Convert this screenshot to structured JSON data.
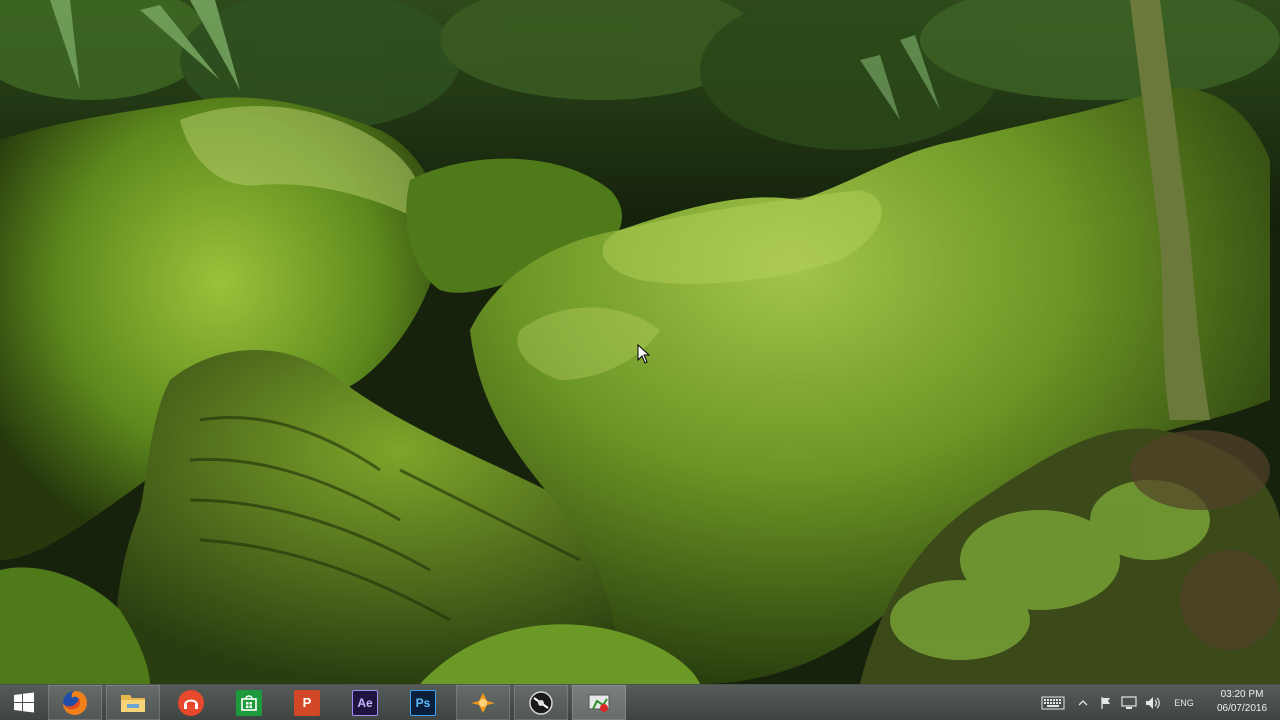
{
  "desktop": {
    "wallpaper_description_icon": "wallpaper-mossy-rocks",
    "colors": {
      "moss_bright": "#8fb52a",
      "moss_mid": "#5f8a1c",
      "moss_dark": "#2f4a10",
      "shadow": "#0f1508"
    }
  },
  "taskbar": {
    "start_icon": "windows-logo-icon",
    "apps": [
      {
        "icon": "firefox-icon",
        "running": true
      },
      {
        "icon": "file-explorer-icon",
        "running": true
      },
      {
        "icon": "music-player-icon",
        "running": false
      },
      {
        "icon": "windows-store-icon",
        "running": false
      },
      {
        "icon": "powerpoint-icon",
        "label": "P",
        "running": false
      },
      {
        "icon": "after-effects-icon",
        "label": "Ae",
        "running": false
      },
      {
        "icon": "photoshop-icon",
        "label": "Ps",
        "running": false
      },
      {
        "icon": "vlc-like-icon",
        "running": true
      },
      {
        "icon": "recorder-icon",
        "running": true
      },
      {
        "icon": "screen-recorder-icon",
        "running": true
      }
    ],
    "tray": {
      "keyboard_icon": "touch-keyboard-icon",
      "chevron_icon": "chevron-up-icon",
      "flag_icon": "action-center-flag-icon",
      "network_icon": "network-icon",
      "volume_icon": "volume-icon",
      "language": "ENG",
      "time": "03:20 PM",
      "date": "06/07/2016"
    }
  }
}
